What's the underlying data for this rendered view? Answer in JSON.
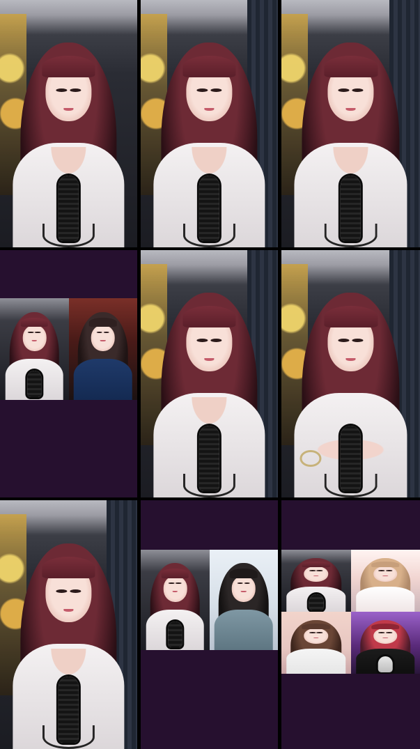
{
  "screen": {
    "background": "#000000",
    "empty_area_color": "#26102f"
  },
  "grid": {
    "rows": 3,
    "cols": 3,
    "cells": [
      {
        "id": "r1c1",
        "type": "single",
        "accent": "#6d2a35"
      },
      {
        "id": "r1c2",
        "type": "single",
        "accent": "#6d2a35"
      },
      {
        "id": "r1c3",
        "type": "single",
        "accent": "#6d2a35"
      },
      {
        "id": "r2c1",
        "type": "split-2"
      },
      {
        "id": "r2c2",
        "type": "single",
        "accent": "#6d2a35"
      },
      {
        "id": "r2c3",
        "type": "single",
        "accent": "#6d2a35"
      },
      {
        "id": "r3c1",
        "type": "single",
        "accent": "#6d2a35"
      },
      {
        "id": "r3c2",
        "type": "split-2"
      },
      {
        "id": "r3c3",
        "type": "split-4"
      }
    ]
  },
  "icons": {
    "microphone": "microphone-icon",
    "panda": "panda-plush",
    "bear": "bear-plush"
  }
}
